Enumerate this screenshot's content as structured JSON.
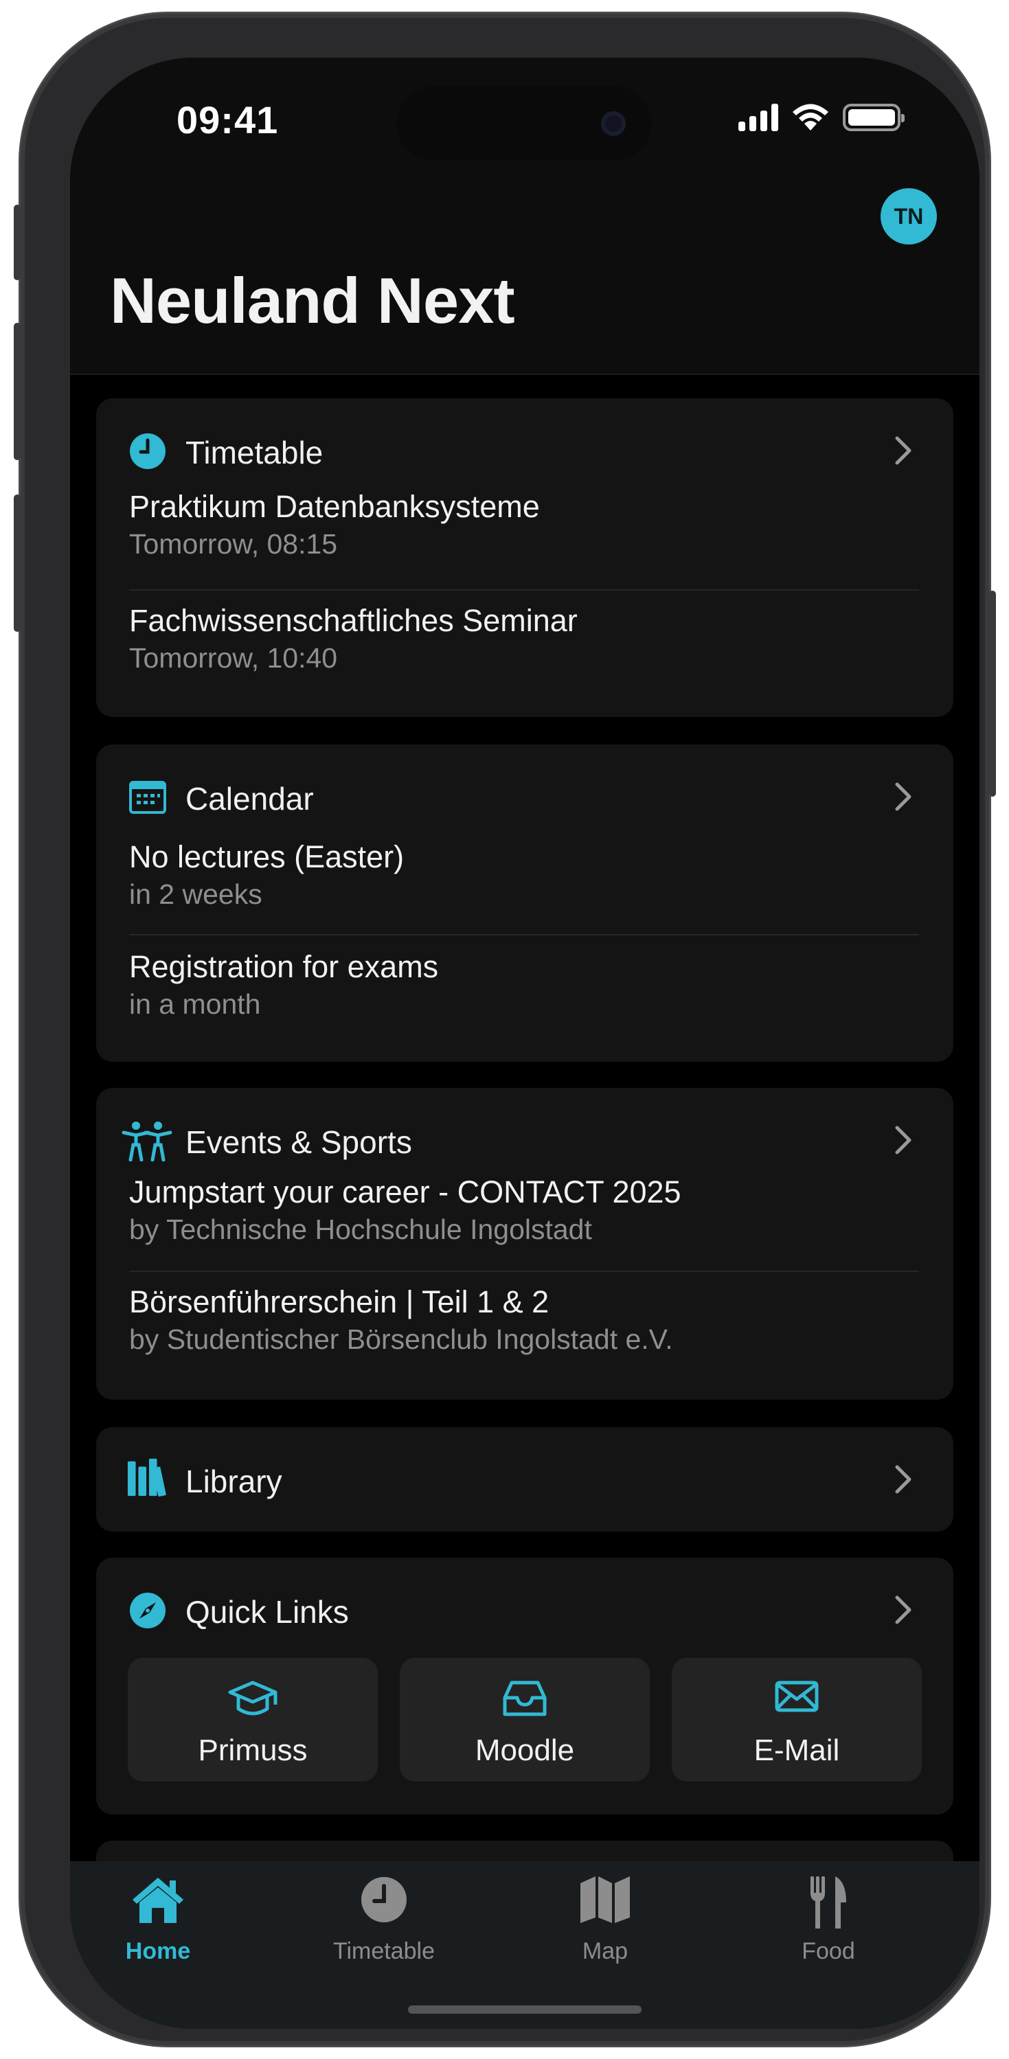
{
  "status_bar": {
    "time": "09:41"
  },
  "header": {
    "avatar_initials": "TN",
    "title": "Neuland Next"
  },
  "cards": {
    "timetable": {
      "title": "Timetable",
      "items": [
        {
          "title": "Praktikum Datenbanksysteme",
          "subtitle": "Tomorrow, 08:15"
        },
        {
          "title": "Fachwissenschaftliches Seminar",
          "subtitle": "Tomorrow, 10:40"
        }
      ]
    },
    "calendar": {
      "title": "Calendar",
      "items": [
        {
          "title": "No lectures (Easter)",
          "subtitle": "in 2 weeks"
        },
        {
          "title": "Registration for exams",
          "subtitle": "in a month"
        }
      ]
    },
    "events": {
      "title": "Events & Sports",
      "items": [
        {
          "title": "Jumpstart your career - CONTACT 2025",
          "subtitle": "by Technische Hochschule Ingolstadt"
        },
        {
          "title": "Börsenführerschein | Teil 1 & 2",
          "subtitle": "by Studentischer Börsenclub Ingolstadt e.V."
        }
      ]
    },
    "library": {
      "title": "Library"
    },
    "quick_links": {
      "title": "Quick Links",
      "links": [
        {
          "label": "Primuss",
          "icon": "graduation-cap-icon"
        },
        {
          "label": "Moodle",
          "icon": "inbox-tray-icon"
        },
        {
          "label": "E-Mail",
          "icon": "envelope-icon"
        }
      ]
    }
  },
  "tabbar": {
    "tabs": [
      {
        "label": "Home",
        "icon": "house-icon",
        "active": true
      },
      {
        "label": "Timetable",
        "icon": "clock-icon",
        "active": false
      },
      {
        "label": "Map",
        "icon": "map-icon",
        "active": false
      },
      {
        "label": "Food",
        "icon": "fork-knife-icon",
        "active": false
      }
    ]
  },
  "colors": {
    "accent": "#32b9d4",
    "background": "#000000",
    "card": "#141414",
    "secondary_text": "#8e8e93"
  }
}
